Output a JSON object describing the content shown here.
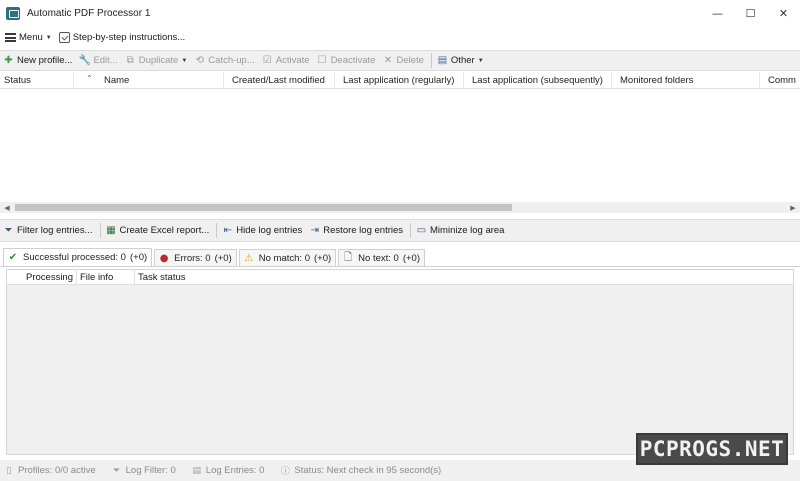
{
  "window": {
    "title": "Automatic PDF Processor 1",
    "minimize": "—",
    "maximize": "☐",
    "close": "✕"
  },
  "menubar": {
    "menu_label": "Menu",
    "step_label": "Step-by-step instructions..."
  },
  "toolbar": [
    {
      "id": "new-profile",
      "label": "New profile...",
      "icon": "plus-icon",
      "glyph": "✚",
      "enabled": true
    },
    {
      "id": "edit",
      "label": "Edit...",
      "icon": "wrench-icon",
      "glyph": "🔧",
      "enabled": false
    },
    {
      "id": "duplicate",
      "label": "Duplicate",
      "icon": "duplicate-icon",
      "glyph": "⧉",
      "enabled": false,
      "dropdown": true
    },
    {
      "id": "catch-up",
      "label": "Catch-up...",
      "icon": "history-icon",
      "glyph": "⟲",
      "enabled": false
    },
    {
      "id": "activate",
      "label": "Activate",
      "icon": "checkbox-checked-icon",
      "glyph": "☑",
      "enabled": false
    },
    {
      "id": "deactivate",
      "label": "Deactivate",
      "icon": "checkbox-empty-icon",
      "glyph": "☐",
      "enabled": false
    },
    {
      "id": "delete",
      "label": "Delete",
      "icon": "delete-x-icon",
      "glyph": "✕",
      "enabled": false
    },
    {
      "id": "other",
      "label": "Other",
      "icon": "other-grid-icon",
      "glyph": "▤",
      "enabled": true,
      "dropdown": true
    }
  ],
  "profiles_columns": [
    "Status",
    "Name",
    "Created/Last modified",
    "Last application (regularly)",
    "Last application (subsequently)",
    "Monitored folders",
    "Comm"
  ],
  "log_toolbar": [
    {
      "id": "filter-log",
      "label": "Filter log entries...",
      "icon": "filter-icon",
      "glyph": "⏷"
    },
    {
      "id": "excel-report",
      "label": "Create Excel report...",
      "icon": "excel-icon",
      "glyph": "▦"
    },
    {
      "id": "hide-log",
      "label": "Hide log entries",
      "icon": "hide-icon",
      "glyph": "⇤"
    },
    {
      "id": "restore-log",
      "label": "Restore log entries",
      "icon": "restore-icon",
      "glyph": "⇥"
    },
    {
      "id": "minimize-log",
      "label": "Miminize log area",
      "icon": "minimize-area-icon",
      "glyph": "▭"
    }
  ],
  "log_tabs": [
    {
      "id": "successful",
      "label": "Successful processed: 0",
      "count": "(+0)",
      "icon": "checkmark-icon",
      "glyph": "✔",
      "color": "#2e8b3a",
      "active": true
    },
    {
      "id": "errors",
      "label": "Errors: 0",
      "count": "(+0)",
      "icon": "error-icon",
      "glyph": "●",
      "color": "#c0272d",
      "active": false
    },
    {
      "id": "no-match",
      "label": "No match: 0",
      "count": "(+0)",
      "icon": "warning-icon",
      "glyph": "⚠",
      "color": "#d9a400",
      "active": false
    },
    {
      "id": "no-text",
      "label": "No text: 0",
      "count": "(+0)",
      "icon": "document-icon",
      "glyph": "🗋",
      "color": "#555555",
      "active": false
    }
  ],
  "log_columns": [
    "Processing",
    "File info",
    "Task status"
  ],
  "statusbar": [
    {
      "id": "profiles",
      "label": "Profiles: 0/0 active",
      "icon": "profile-doc-icon",
      "glyph": "▯"
    },
    {
      "id": "log-filter",
      "label": "Log Filter: 0",
      "icon": "filter-icon",
      "glyph": "⏷"
    },
    {
      "id": "log-entries",
      "label": "Log Entries: 0",
      "icon": "list-icon",
      "glyph": "▤"
    },
    {
      "id": "status",
      "label": "Status: Next check in 95 second(s)",
      "icon": "info-icon",
      "glyph": "ⓘ"
    }
  ],
  "watermark": "PCPROGS.NET"
}
